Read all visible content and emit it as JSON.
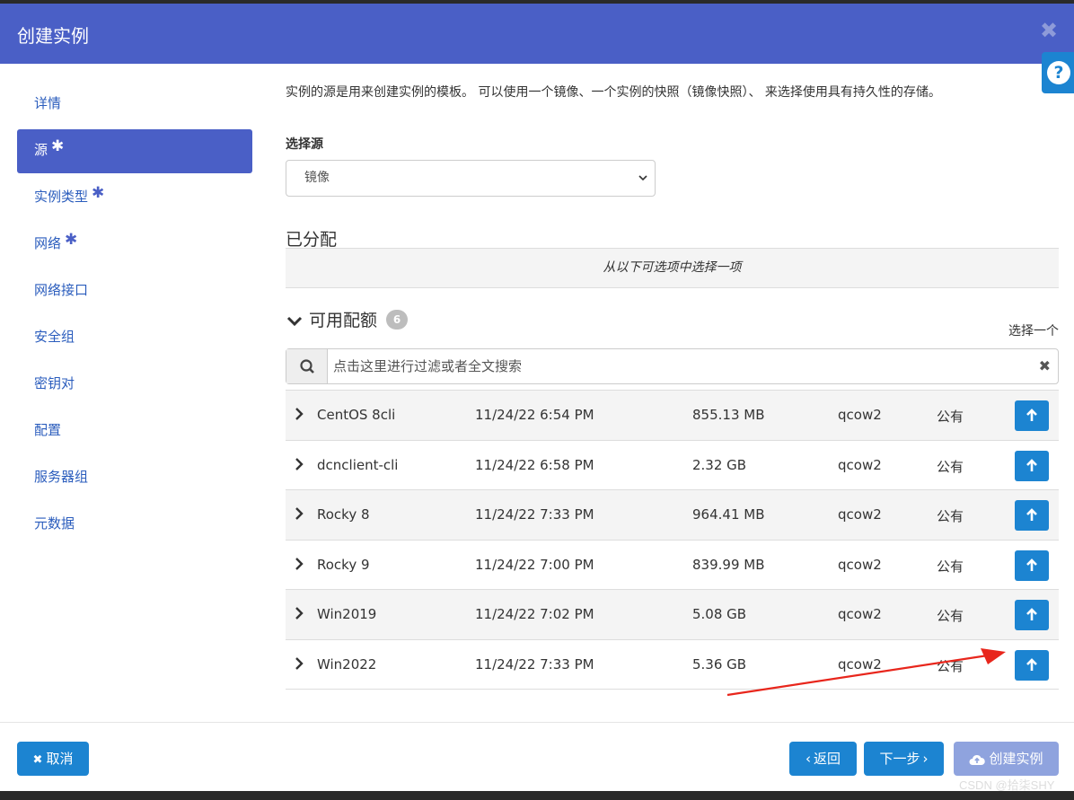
{
  "header": {
    "title": "创建实例",
    "close_symbol": "✖",
    "help_symbol": "?"
  },
  "sidebar": {
    "items": [
      {
        "label": "详情",
        "required": false
      },
      {
        "label": "源",
        "required": true
      },
      {
        "label": "实例类型",
        "required": true
      },
      {
        "label": "网络",
        "required": true
      },
      {
        "label": "网络接口",
        "required": false
      },
      {
        "label": "安全组",
        "required": false
      },
      {
        "label": "密钥对",
        "required": false
      },
      {
        "label": "配置",
        "required": false
      },
      {
        "label": "服务器组",
        "required": false
      },
      {
        "label": "元数据",
        "required": false
      }
    ],
    "active_index": 1,
    "required_mark": "✱"
  },
  "main": {
    "description": "实例的源是用来创建实例的模板。 可以使用一个镜像、一个实例的快照（镜像快照）、 来选择使用具有持久性的存储。",
    "select_source_label": "选择源",
    "select_source_value": "镜像",
    "allocated_title": "已分配",
    "allocated_empty": "从以下可选项中选择一项",
    "available_title": "可用配额",
    "available_count": "6",
    "pick_one": "选择一个",
    "search_placeholder": "点击这里进行过滤或者全文搜索"
  },
  "images": [
    {
      "name": "CentOS 8cli",
      "updated": "11/24/22 6:54 PM",
      "size": "855.13 MB",
      "format": "qcow2",
      "visibility": "公有"
    },
    {
      "name": "dcnclient-cli",
      "updated": "11/24/22 6:58 PM",
      "size": "2.32 GB",
      "format": "qcow2",
      "visibility": "公有"
    },
    {
      "name": "Rocky 8",
      "updated": "11/24/22 7:33 PM",
      "size": "964.41 MB",
      "format": "qcow2",
      "visibility": "公有"
    },
    {
      "name": "Rocky 9",
      "updated": "11/24/22 7:00 PM",
      "size": "839.99 MB",
      "format": "qcow2",
      "visibility": "公有"
    },
    {
      "name": "Win2019",
      "updated": "11/24/22 7:02 PM",
      "size": "5.08 GB",
      "format": "qcow2",
      "visibility": "公有"
    },
    {
      "name": "Win2022",
      "updated": "11/24/22 7:33 PM",
      "size": "5.36 GB",
      "format": "qcow2",
      "visibility": "公有"
    }
  ],
  "footer": {
    "cancel_label": "取消",
    "back_label": "返回",
    "next_label": "下一步",
    "create_label": "创建实例"
  },
  "watermark": "CSDN @拾柒SHY",
  "colors": {
    "header": "#4a5fc6",
    "primary": "#1c84d1",
    "disabled": "#8fa3de",
    "arrow": "#e8261c"
  }
}
